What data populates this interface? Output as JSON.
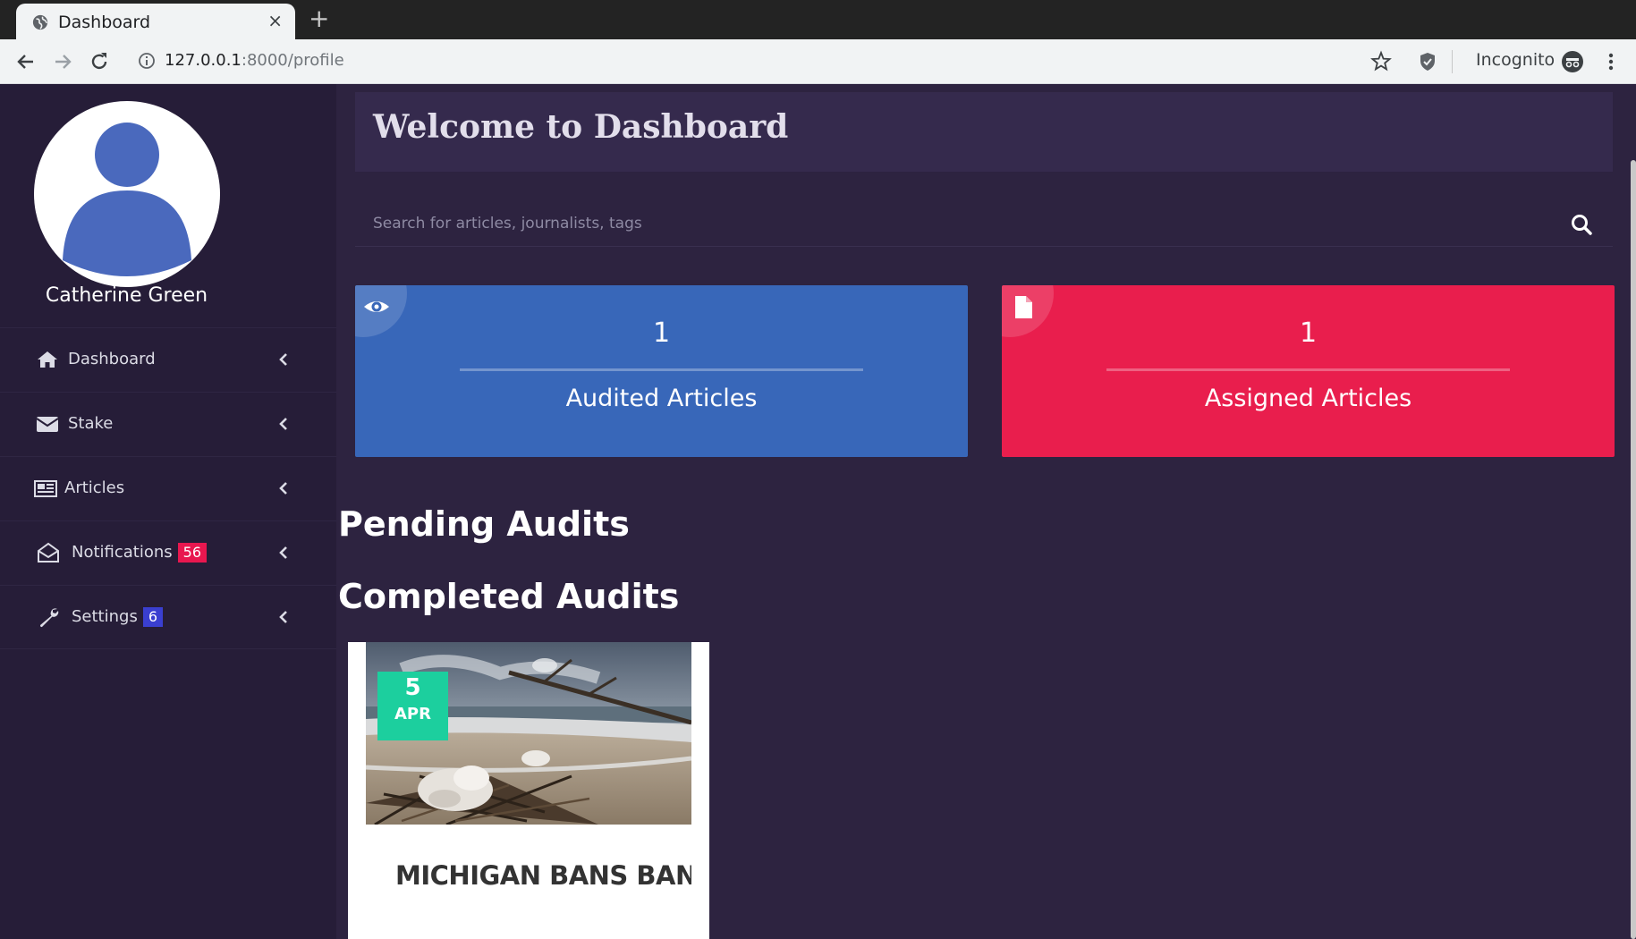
{
  "browser": {
    "tab_title": "Dashboard",
    "tab_close": "×",
    "new_tab": "+",
    "url_host": "127.0.0.1",
    "url_rest": ":8000/profile",
    "incognito_label": "Incognito"
  },
  "sidebar": {
    "profile_name": "Catherine Green",
    "items": [
      {
        "label": "Dashboard",
        "icon": "home-icon"
      },
      {
        "label": "Stake",
        "icon": "envelope-icon"
      },
      {
        "label": "Articles",
        "icon": "newspaper-icon"
      },
      {
        "label": "Notifications",
        "icon": "envelope-open-icon",
        "badge": "56",
        "badge_color": "#e8174f"
      },
      {
        "label": "Settings",
        "icon": "wrench-icon",
        "badge": "6",
        "badge_color": "#3a3fd0"
      }
    ]
  },
  "main": {
    "welcome_title": "Welcome to Dashboard",
    "search_placeholder": "Search for articles, journalists, tags",
    "stats": [
      {
        "value": "1",
        "label": "Audited Articles",
        "color": "#3867b9",
        "icon": "eye-icon"
      },
      {
        "value": "1",
        "label": "Assigned Articles",
        "color": "#e91e4d",
        "icon": "file-icon"
      }
    ],
    "pending_title": "Pending Audits",
    "completed_title": "Completed Audits",
    "completed_audits": [
      {
        "day": "5",
        "month": "APR",
        "title": "MICHIGAN BANS BANNING"
      }
    ]
  },
  "colors": {
    "page_bg": "#2d2340",
    "sidebar_bg": "#261d38",
    "welcome_bg": "#352a4d",
    "date_badge": "#1ccf9e"
  }
}
